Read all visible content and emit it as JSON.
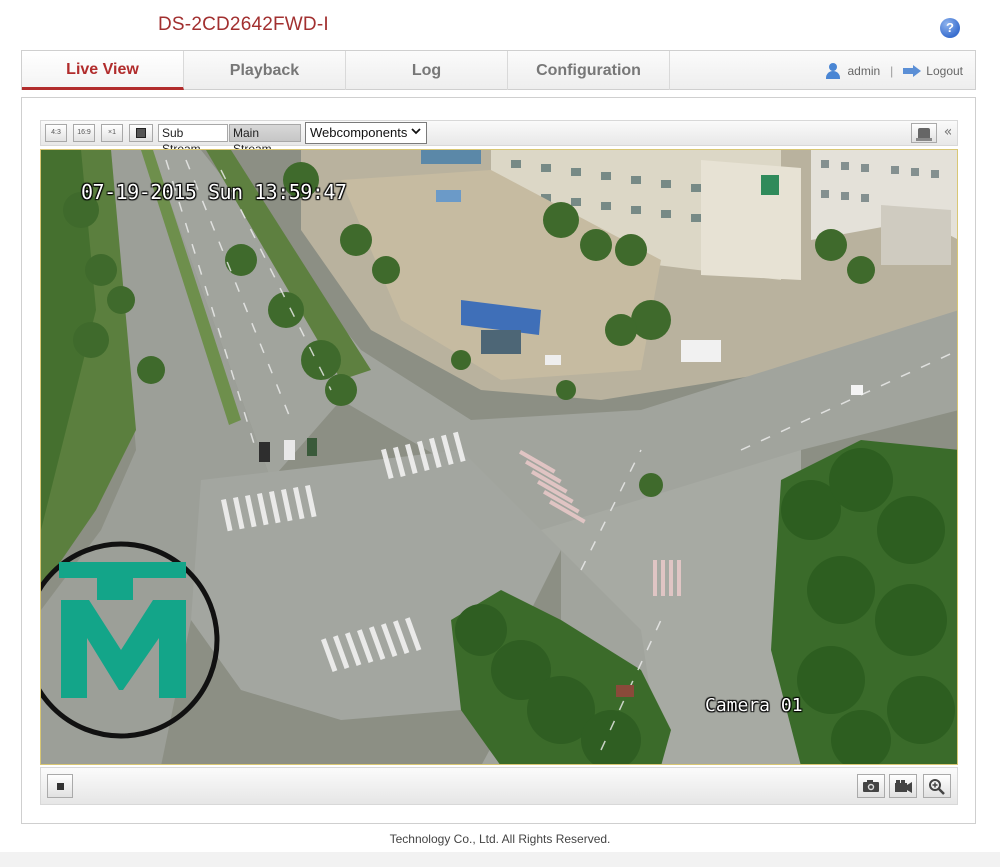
{
  "device": {
    "model": "DS-2CD2642FWD-I"
  },
  "header": {
    "help_label": "?"
  },
  "nav": {
    "tabs": [
      {
        "label": "Live View"
      },
      {
        "label": "Playback"
      },
      {
        "label": "Log"
      },
      {
        "label": "Configuration"
      }
    ],
    "active_tab": "Live View",
    "user": "admin",
    "separator": "|",
    "logout_label": "Logout"
  },
  "toolbar": {
    "ratio_43": "4:3",
    "ratio_169": "16:9",
    "ratio_x1": "×1",
    "sub_stream": "Sub Stream",
    "main_stream": "Main Stream",
    "plugin_select": "Webcomponents",
    "collapse": "«"
  },
  "video": {
    "osd_datetime": "07-19-2015 Sun 13:59:47",
    "osd_camera": "Camera 01"
  },
  "footer": {
    "copyright": "Technology Co., Ltd. All Rights Reserved."
  },
  "colors": {
    "accent": "#b12c2c",
    "title": "#a23030",
    "watermark": "#13a589"
  }
}
